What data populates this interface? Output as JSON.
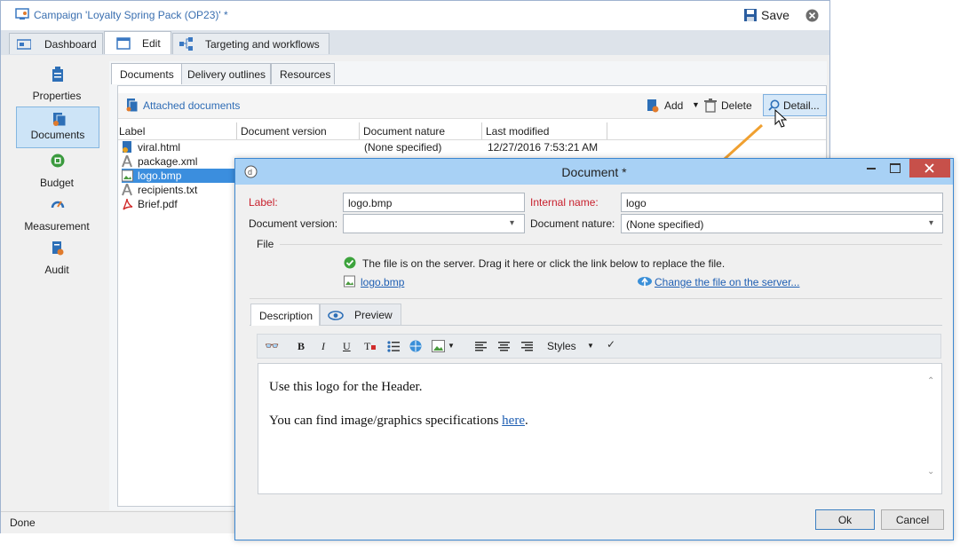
{
  "window": {
    "title": "Campaign 'Loyalty Spring Pack (OP23)' *",
    "save_label": "Save"
  },
  "top_tabs": [
    {
      "label": "Dashboard"
    },
    {
      "label": "Edit"
    },
    {
      "label": "Targeting and workflows"
    }
  ],
  "left_nav": [
    {
      "label": "Properties"
    },
    {
      "label": "Documents"
    },
    {
      "label": "Budget"
    },
    {
      "label": "Measurement"
    },
    {
      "label": "Audit"
    }
  ],
  "sub_tabs": [
    {
      "label": "Documents"
    },
    {
      "label": "Delivery outlines"
    },
    {
      "label": "Resources"
    }
  ],
  "documents_toolbar": {
    "title": "Attached documents",
    "add_label": "Add",
    "delete_label": "Delete",
    "detail_label": "Detail..."
  },
  "grid": {
    "columns": [
      "Label",
      "Document version",
      "Document nature",
      "Last modified"
    ],
    "rows": [
      {
        "label": "viral.html",
        "nature": "(None specified)",
        "modified": "12/27/2016 7:53:21 AM"
      },
      {
        "label": "package.xml",
        "nature": "",
        "modified": ""
      },
      {
        "label": "logo.bmp",
        "nature": "",
        "modified": ""
      },
      {
        "label": "recipients.txt",
        "nature": "",
        "modified": ""
      },
      {
        "label": "Brief.pdf",
        "nature": "",
        "modified": ""
      }
    ]
  },
  "status": {
    "text": "Done"
  },
  "dialog": {
    "title": "Document *",
    "label_caption": "Label:",
    "label_value": "logo.bmp",
    "internal_name_caption": "Internal name:",
    "internal_name_value": "logo",
    "doc_version_caption": "Document version:",
    "doc_version_value": "",
    "doc_nature_caption": "Document nature:",
    "doc_nature_value": "(None specified)",
    "file_group": "File",
    "file_message": "The file is on the server. Drag it here or click the link below to replace the file.",
    "file_link": "logo.bmp",
    "change_file_link": "Change the file on the server...",
    "tabs": [
      {
        "label": "Description"
      },
      {
        "label": "Preview"
      }
    ],
    "editor": {
      "styles_label": "Styles",
      "line1": "Use this logo for the Header.",
      "line2_prefix": "You can find image/graphics specifications ",
      "line2_link": "here",
      "line2_suffix": "."
    },
    "ok_label": "Ok",
    "cancel_label": "Cancel"
  },
  "colors": {
    "accent": "#3b87d1",
    "selection": "#cde4f7",
    "required_label": "#c8202d",
    "arrow": "#f0a030"
  }
}
